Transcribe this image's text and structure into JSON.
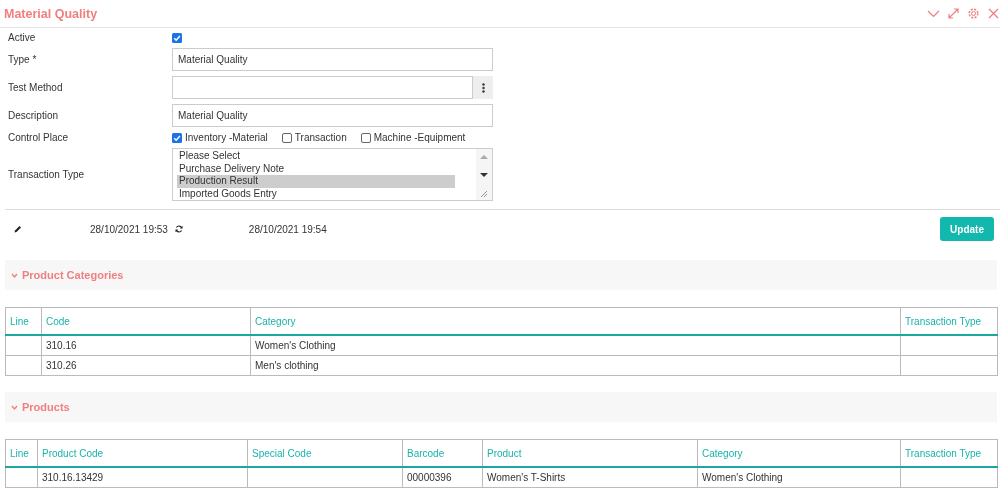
{
  "panel": {
    "title": "Material Quality"
  },
  "form": [
    {
      "kind": "checkbox",
      "label": "Active",
      "checked": true
    },
    {
      "kind": "text",
      "label": "Type *",
      "value": "Material Quality"
    },
    {
      "kind": "lookup",
      "label": "Test Method"
    },
    {
      "kind": "text",
      "label": "Description",
      "value": "Material Quality"
    },
    {
      "kind": "checkgroup",
      "label": "Control Place",
      "options": [
        {
          "label": "Inventory -Material",
          "checked": true
        },
        {
          "label": "Transaction",
          "checked": false
        },
        {
          "label": "Machine -Equipment",
          "checked": false
        }
      ]
    },
    {
      "kind": "listbox",
      "label": "Transaction Type",
      "options": [
        {
          "label": "Please Select",
          "selected": false
        },
        {
          "label": "Purchase Delivery Note",
          "selected": false
        },
        {
          "label": "Production Result",
          "selected": true
        },
        {
          "label": "Imported Goods Entry",
          "selected": false
        }
      ]
    }
  ],
  "meta": {
    "created": "28/10/2021 19:53",
    "updated": "28/10/2021 19:54",
    "button": "Update"
  },
  "sections": [
    {
      "title": "Product Categories",
      "expanded": true,
      "table": {
        "columns": [
          "Line",
          "Code",
          "Category",
          "Transaction Type"
        ],
        "rows": [
          [
            null,
            "310.16",
            "Women's Clothing",
            null
          ],
          [
            null,
            "310.26",
            "Men's clothing",
            null
          ]
        ]
      }
    },
    {
      "title": "Products",
      "expanded": true,
      "table": {
        "columns": [
          "Line",
          "Product Code",
          "Special Code",
          "Barcode",
          "Product",
          "Category",
          "Transaction Type"
        ],
        "rows": [
          [
            null,
            "310.16.13429",
            null,
            "00000396",
            "Women's T-Shirts",
            "Women's Clothing",
            null
          ]
        ]
      }
    }
  ]
}
